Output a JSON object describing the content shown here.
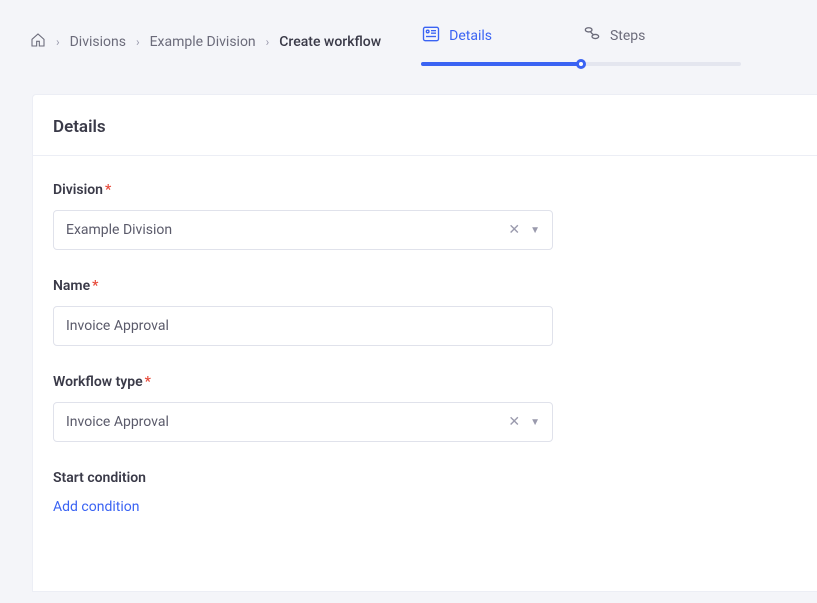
{
  "breadcrumb": {
    "items": [
      "Divisions",
      "Example Division"
    ],
    "current": "Create workflow"
  },
  "wizard": {
    "steps": [
      {
        "label": "Details",
        "active": true
      },
      {
        "label": "Steps",
        "active": false
      }
    ]
  },
  "panel": {
    "title": "Details"
  },
  "form": {
    "division": {
      "label": "Division",
      "value": "Example Division"
    },
    "name": {
      "label": "Name",
      "value": "Invoice Approval"
    },
    "workflow_type": {
      "label": "Workflow type",
      "value": "Invoice Approval"
    },
    "start_condition": {
      "label": "Start condition",
      "add_label": "Add condition"
    }
  }
}
